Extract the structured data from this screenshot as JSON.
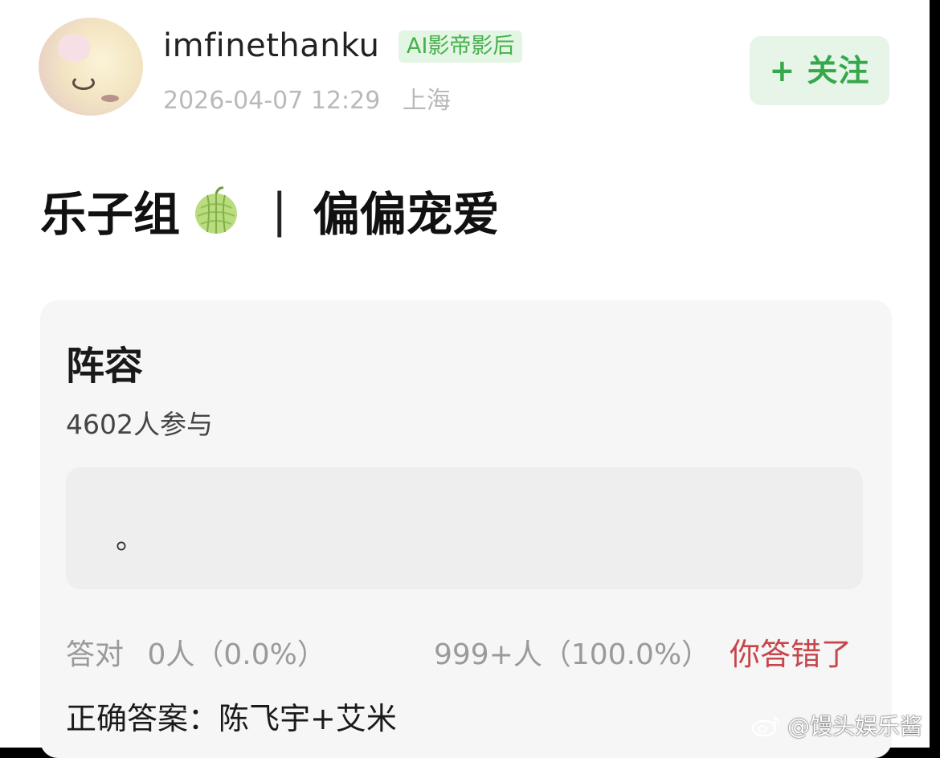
{
  "post": {
    "username": "imfinethanku",
    "badge": "AI影帝影后",
    "date": "2026-04-07 12:29",
    "location": "上海",
    "follow_label": "+ 关注",
    "title_left": "乐子组",
    "title_separator": "|",
    "title_right": "偏偏宠爱"
  },
  "quiz": {
    "title": "阵容",
    "participants": "4602人参与",
    "option_text": "。",
    "correct_label": "答对",
    "correct_stats": "0人（0.0%）",
    "other_stats": "999+人（100.0%）",
    "result": "你答错了",
    "answer": "正确答案：陈飞宇+艾米"
  },
  "watermark": {
    "text": "@馒头娱乐酱"
  },
  "icons": {
    "title_emoji": "melon-icon",
    "watermark": "weibo-logo-icon"
  },
  "colors": {
    "follow_green": "#34a84a",
    "badge_green": "#45b04b",
    "wrong_red": "#c7454b"
  }
}
